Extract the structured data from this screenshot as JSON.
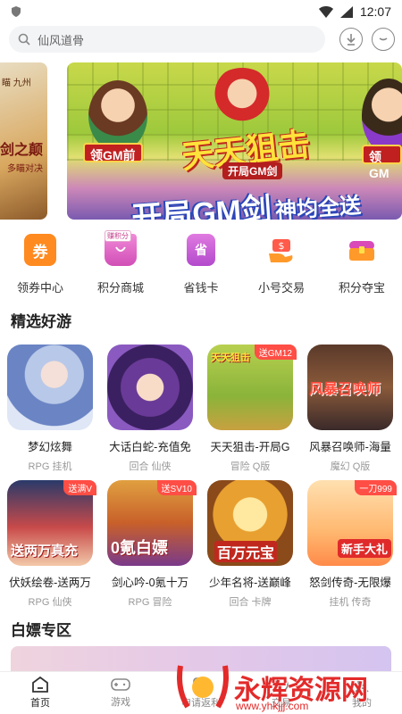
{
  "status": {
    "time": "12:07"
  },
  "search": {
    "placeholder": "仙风道骨"
  },
  "banner": {
    "left_tag": "瞄 九州",
    "left_title": "剑之颠",
    "left_sub": "多瞄对决",
    "title": "天天狙击",
    "subtitle": "开局GM剑",
    "big": "开局GM剑",
    "big_tail": "神均全送",
    "ribbon_left": "领GM前",
    "ribbon_right": "领GM"
  },
  "quicknav": [
    {
      "label": "领券中心",
      "icon": "coupon-icon",
      "glyph": "券",
      "color": "#ff8a1f"
    },
    {
      "label": "积分商城",
      "icon": "shopping-bag-icon",
      "glyph": "",
      "badge": "赚积分",
      "color": "#e46cc6"
    },
    {
      "label": "省钱卡",
      "icon": "card-icon",
      "glyph": "省",
      "color": "#c85ad8"
    },
    {
      "label": "小号交易",
      "icon": "trade-icon",
      "glyph": "$",
      "color": "#ff8a1f"
    },
    {
      "label": "积分夺宝",
      "icon": "treasure-chest-icon",
      "glyph": "",
      "color": "#d94ab8"
    }
  ],
  "sections": {
    "featured": "精选好游",
    "free": "白嫖专区"
  },
  "games_row1": [
    {
      "name": "梦幻炫舞",
      "tags": "RPG 挂机",
      "badge": "",
      "cover_text": ""
    },
    {
      "name": "大话白蛇-充值免",
      "tags": "回合 仙侠",
      "badge": "",
      "cover_text": ""
    },
    {
      "name": "天天狙击-开局G",
      "tags": "冒险 Q版",
      "badge": "送GM12",
      "cover_text": "天天狙击"
    },
    {
      "name": "风暴召唤师-海量",
      "tags": "魔幻 Q版",
      "badge": "",
      "cover_text": "风暴召唤师"
    }
  ],
  "games_row2": [
    {
      "name": "伏妖绘卷-送两万",
      "tags": "RPG 仙侠",
      "badge": "送满V",
      "cover_text": "送两万真充"
    },
    {
      "name": "剑心吟-0氪十万",
      "tags": "RPG 冒险",
      "badge": "送SV10",
      "cover_text": "0氪白嫖"
    },
    {
      "name": "少年名将-送巅峰",
      "tags": "回合 卡牌",
      "badge": "",
      "cover_text": "百万元宝"
    },
    {
      "name": "怒剑传奇-无限爆",
      "tags": "挂机 传奇",
      "badge": "一刀999",
      "cover_text": "新手大礼"
    }
  ],
  "bottom_nav": [
    {
      "label": "首页",
      "icon": "home-icon",
      "active": true
    },
    {
      "label": "游戏",
      "icon": "gamepad-icon",
      "active": false
    },
    {
      "label": "申请返利",
      "icon": "rebate-icon",
      "active": false
    },
    {
      "label": "交易",
      "icon": "trade-nav-icon",
      "active": false
    },
    {
      "label": "我的",
      "icon": "profile-icon",
      "active": false
    }
  ],
  "watermark": {
    "text": "永辉资源网",
    "url": "www.yhkjjj.com"
  }
}
